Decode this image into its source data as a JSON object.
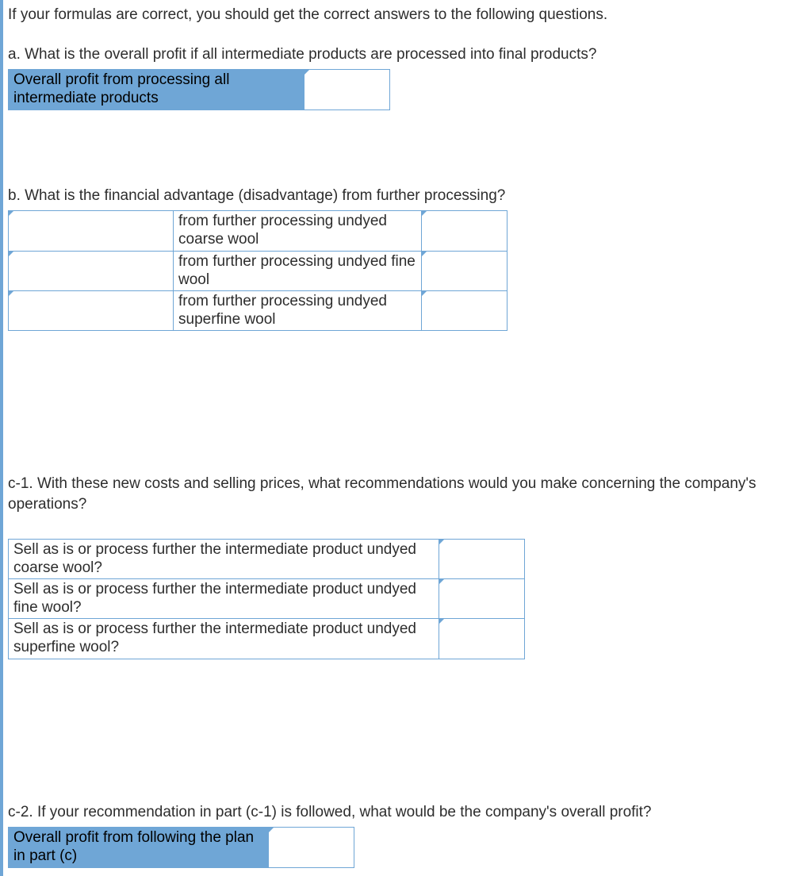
{
  "intro": "If your formulas are correct, you should get the correct answers to the following questions.",
  "a": {
    "prompt": "a. What is the overall profit if all intermediate products are processed into final products?",
    "label": "Overall profit from processing all intermediate products",
    "value": ""
  },
  "b": {
    "prompt": "b. What is the financial advantage (disadvantage) from further processing?",
    "rows": [
      {
        "left": "",
        "desc": "from further processing undyed coarse wool",
        "value": ""
      },
      {
        "left": "",
        "desc": "from further processing undyed fine wool",
        "value": ""
      },
      {
        "left": "",
        "desc": "from further processing undyed superfine wool",
        "value": ""
      }
    ]
  },
  "c1": {
    "prompt": "c-1. With these new costs and selling prices, what recommendations would you make concerning the company's operations?",
    "rows": [
      {
        "q": "Sell as is or process further the intermediate product undyed coarse wool?",
        "value": ""
      },
      {
        "q": "Sell as is or process further the intermediate product undyed fine wool?",
        "value": ""
      },
      {
        "q": "Sell as is or process further the intermediate product undyed superfine wool?",
        "value": ""
      }
    ]
  },
  "c2": {
    "prompt": "c-2. If your recommendation in part (c-1) is followed, what would be the company's overall profit?",
    "label": "Overall profit from following the plan in part (c)",
    "value": ""
  }
}
